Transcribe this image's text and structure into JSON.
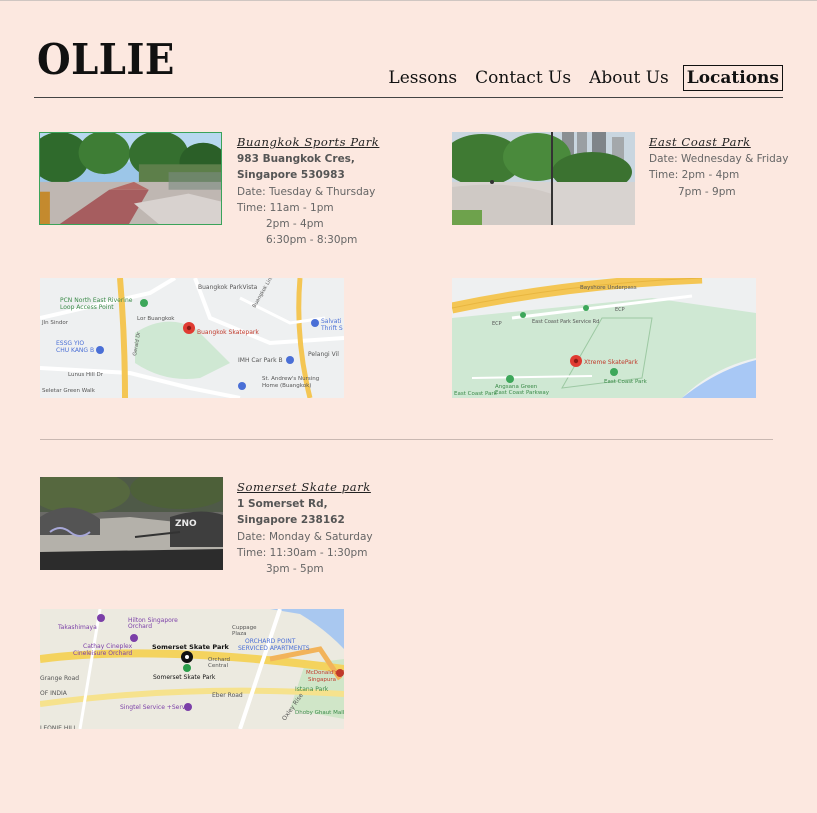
{
  "brand": {
    "logo": "OLLIE"
  },
  "nav": {
    "lessons": "Lessons",
    "contact": "Contact Us",
    "about": "About Us",
    "locations": "Locations"
  },
  "locations": [
    {
      "name": "Buangkok Sports Park",
      "address1": "983 Buangkok Cres,",
      "address2": "Singapore 530983",
      "date": "Date: Tuesday & Thursday",
      "time1": "Time: 11am - 1pm",
      "time2": "2pm - 4pm",
      "time3": "6:30pm - 8:30pm",
      "map_labels": [
        "Buangkok ParkVista",
        "PCN North East Riverine Loop Access Point",
        "Lor Buangkok",
        "Jln Sindor",
        "Buangkok Skatepark",
        "ESSG YIO CHU KANG B",
        "IMH Car Park B",
        "Salvation Thrift St",
        "Pelangi Vil",
        "Lunus Hill Dr",
        "St. Andrew's Nursing Home (Buangkok)",
        "Seletar Green Walk",
        "Buangkok Link",
        "Gerald Dr"
      ]
    },
    {
      "name": "East Coast Park",
      "date": "Date: Wednesday & Friday",
      "time1": "Time: 2pm - 4pm",
      "time2": "7pm - 9pm",
      "map_labels": [
        "Bayshore Underpass",
        "ECP",
        "East Coast Park Service Rd",
        "Xtreme SkatePark",
        "Angsana Green East Coast Parkway",
        "East Coast Park"
      ]
    },
    {
      "name": "Somerset Skate park",
      "address1": "1 Somerset Rd,",
      "address2": "Singapore 238162",
      "date": "Date: Monday & Saturday",
      "time1": "Time: 11:30am - 1:30pm",
      "time2": "3pm - 5pm",
      "map_labels": [
        "Takashimaya",
        "Hilton Singapore Orchard",
        "Cuppage Plaza",
        "Cathay Cineplex Cineleisure Orchard",
        "Somerset Skate Park",
        "ORCHARD POINT SERVICED APARTMENTS",
        "Orchard Central",
        "Somerset Skate Park",
        "McDonald's Plaza Singapura",
        "Istana Park",
        "OF INDIA",
        "Eber Road",
        "Singtel Service +Serv",
        "Dhoby Ghaut Mall",
        "Oxley Rise",
        "LEONIE HILL",
        "Grange Road"
      ]
    }
  ]
}
